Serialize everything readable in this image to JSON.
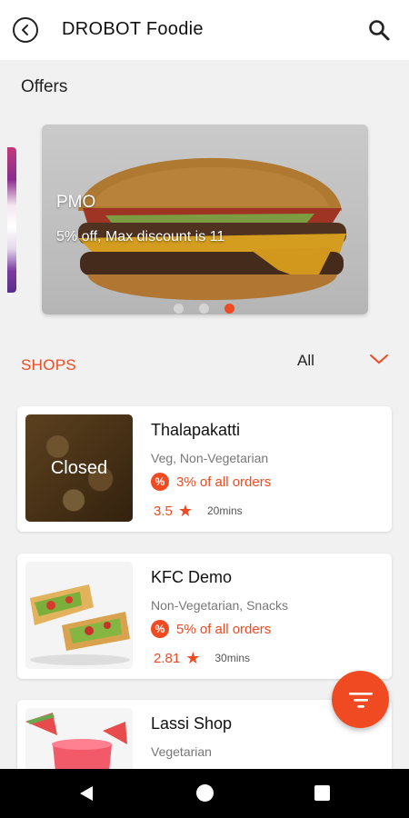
{
  "appbar": {
    "title": "DROBOT Foodie",
    "back_icon": "back-circle-icon",
    "search_icon": "search-icon"
  },
  "offers": {
    "label": "Offers",
    "banner": {
      "title": "PMO",
      "subtitle": "5% off, Max discount is 11",
      "dots_count": 3,
      "active_dot": 3
    }
  },
  "shops": {
    "label": "SHOPS",
    "filter_value": "All",
    "items": [
      {
        "name": "Thalapakatti",
        "category": "Veg, Non-Vegetarian",
        "offer_badge": "%",
        "offer": "3% of all orders",
        "rating": "3.5",
        "time": "20mins",
        "status": "Closed"
      },
      {
        "name": "KFC Demo",
        "category": "Non-Vegetarian, Snacks",
        "offer_badge": "%",
        "offer": "5% of all orders",
        "rating": "2.81",
        "time": "30mins"
      },
      {
        "name": "Lassi Shop",
        "category": "Vegetarian"
      }
    ]
  },
  "colors": {
    "accent": "#f04a23",
    "background": "#f1f1f1"
  },
  "fab": {
    "icon": "filter-icon"
  }
}
